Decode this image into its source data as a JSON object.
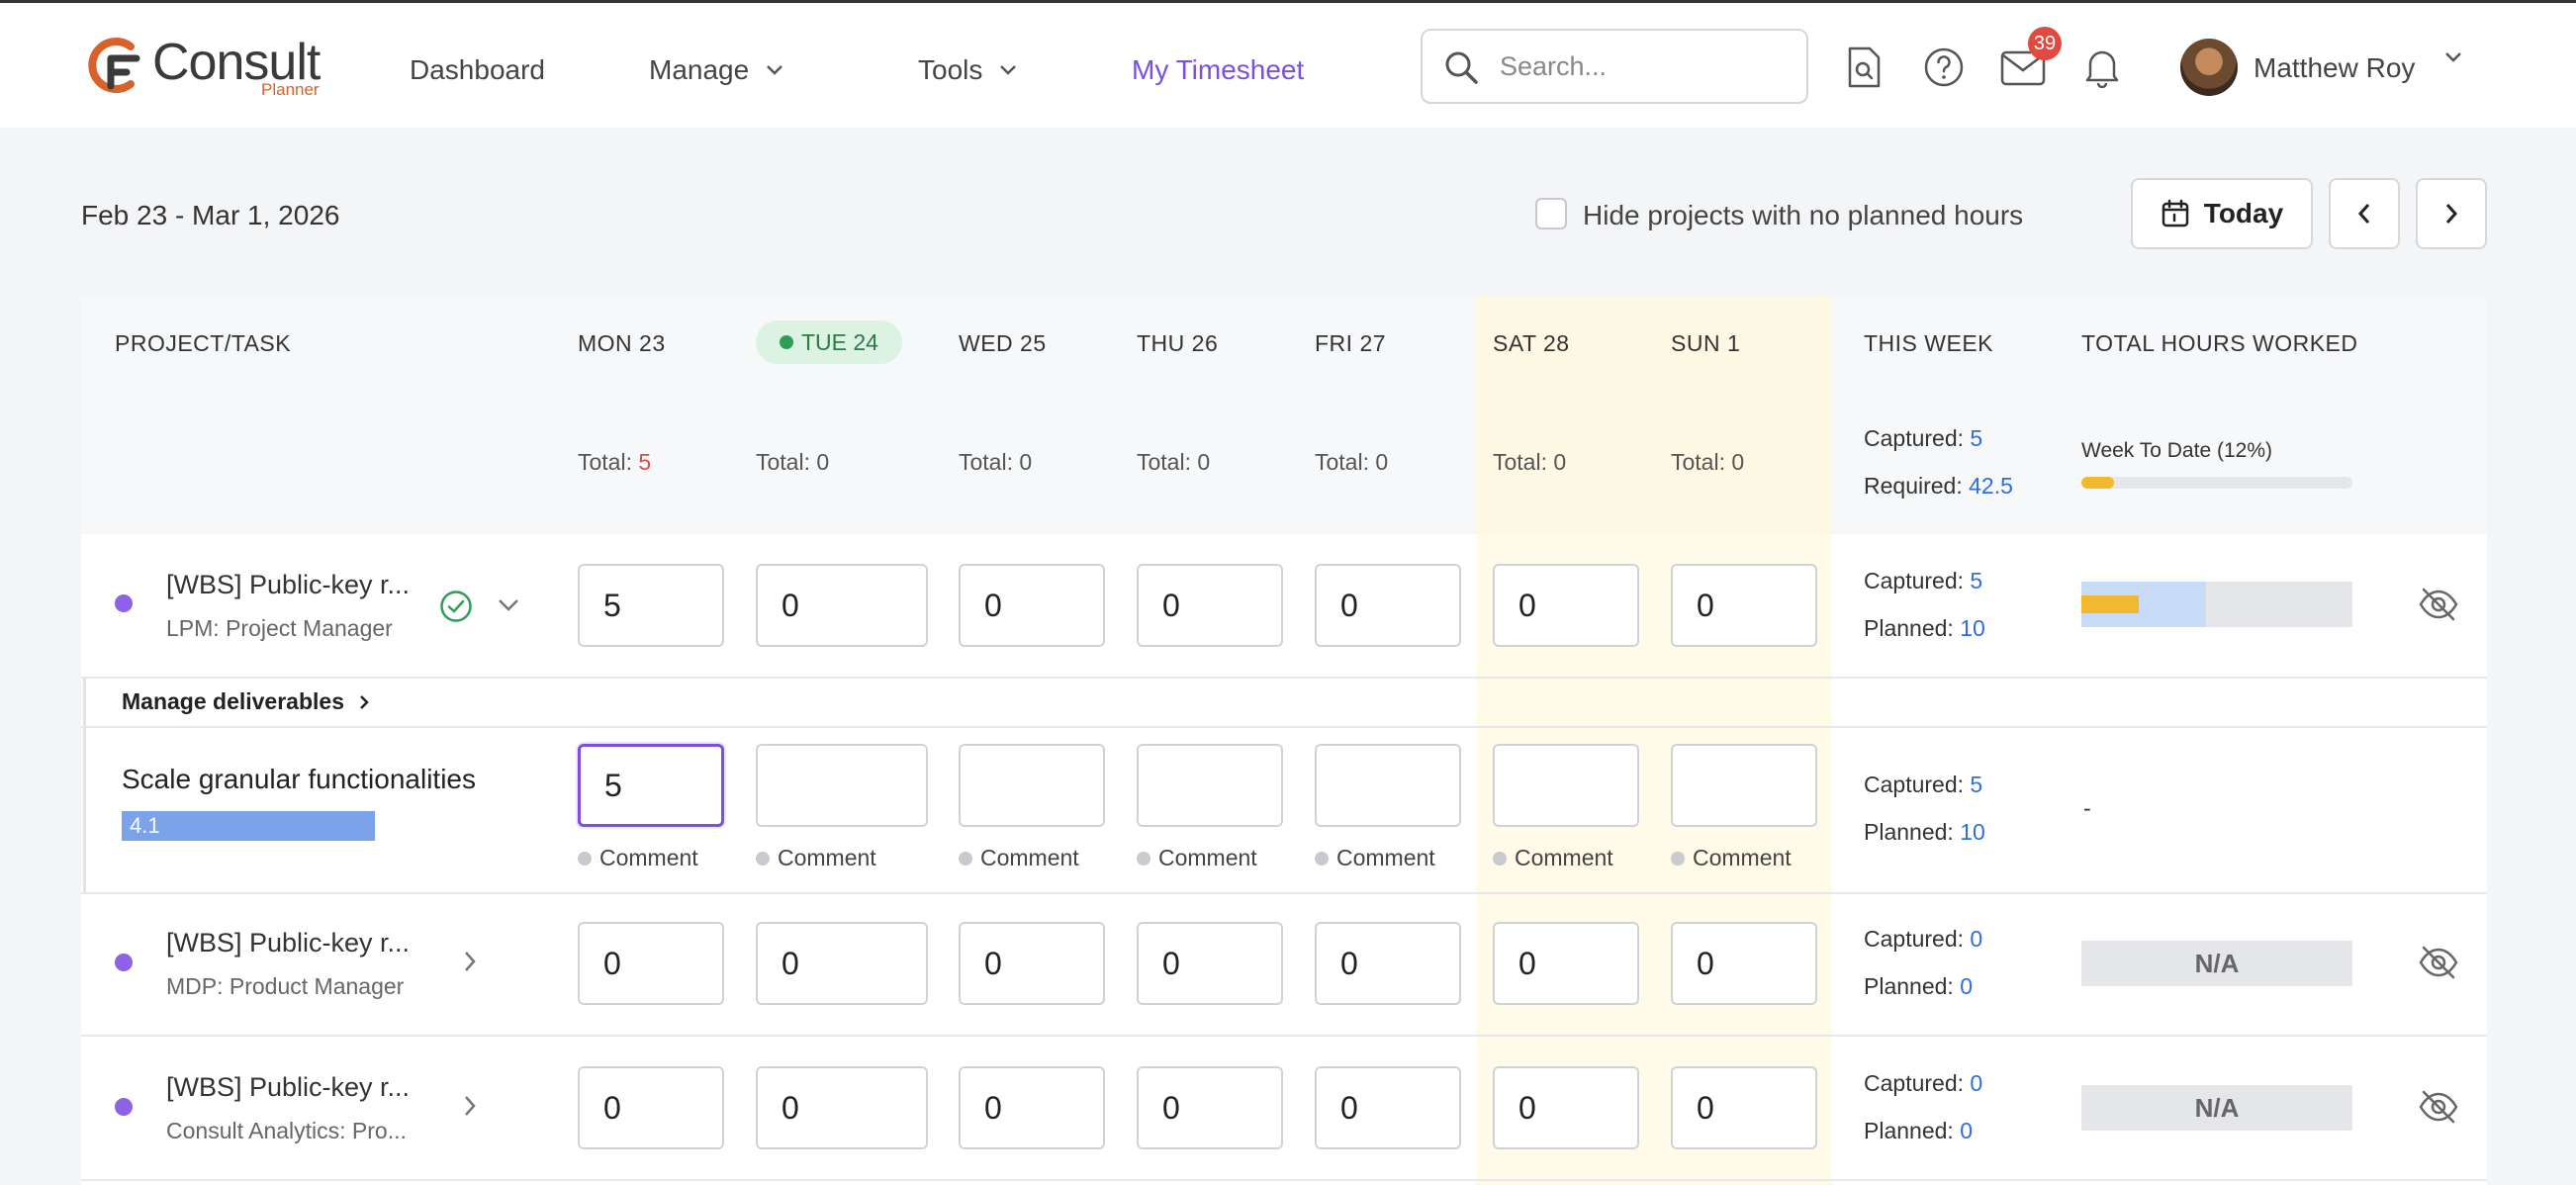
{
  "header": {
    "logo": {
      "word": "Consult",
      "sub": "Planner"
    },
    "nav": [
      {
        "label": "Dashboard"
      },
      {
        "label": "Manage"
      },
      {
        "label": "Tools"
      },
      {
        "label": "My Timesheet"
      }
    ],
    "search": {
      "placeholder": "Search..."
    },
    "notifications_count": "39",
    "user": {
      "name": "Matthew Roy"
    }
  },
  "toolbar": {
    "date_range": "Feb 23 - Mar 1, 2026",
    "hide_label": "Hide projects with no planned hours",
    "today_label": "Today"
  },
  "table": {
    "columns": {
      "project": "PROJECT/TASK",
      "days": [
        "MON 23",
        "TUE 24",
        "WED 25",
        "THU 26",
        "FRI 27",
        "SAT 28",
        "SUN 1"
      ],
      "this_week": "THIS WEEK",
      "total_hours": "TOTAL HOURS WORKED"
    },
    "total_label": "Total:",
    "day_totals": [
      "5",
      "0",
      "0",
      "0",
      "0",
      "0",
      "0"
    ],
    "summary": {
      "captured_label": "Captured:",
      "captured": "5",
      "required_label": "Required:",
      "required": "42.5",
      "week_to_date": "Week To Date (12%)",
      "week_to_date_fraction": 0.12
    },
    "planned_label": "Planned:",
    "comment_label": "Comment",
    "deliverables_label": "Manage deliverables",
    "na_label": "N/A",
    "na_dash": "-",
    "rows": [
      {
        "name": "[WBS] Public-key r...",
        "role": "LPM: Project Manager",
        "hours": [
          "5",
          "0",
          "0",
          "0",
          "0",
          "0",
          "0"
        ],
        "captured": "5",
        "planned": "10",
        "captured_fraction": 0.21,
        "planned_fraction": 0.46
      },
      {
        "name": "[WBS] Public-key r...",
        "role": "MDP: Product Manager",
        "hours": [
          "0",
          "0",
          "0",
          "0",
          "0",
          "0",
          "0"
        ],
        "captured": "0",
        "planned": "0"
      },
      {
        "name": "[WBS] Public-key r...",
        "role": "Consult Analytics: Pro...",
        "hours": [
          "0",
          "0",
          "0",
          "0",
          "0",
          "0",
          "0"
        ],
        "captured": "0",
        "planned": "0"
      }
    ],
    "task": {
      "name": "Scale granular functionalities",
      "wbs": "4.1",
      "hours": [
        "5",
        "",
        "",
        "",
        "",
        "",
        ""
      ],
      "captured": "5",
      "planned": "10"
    }
  }
}
